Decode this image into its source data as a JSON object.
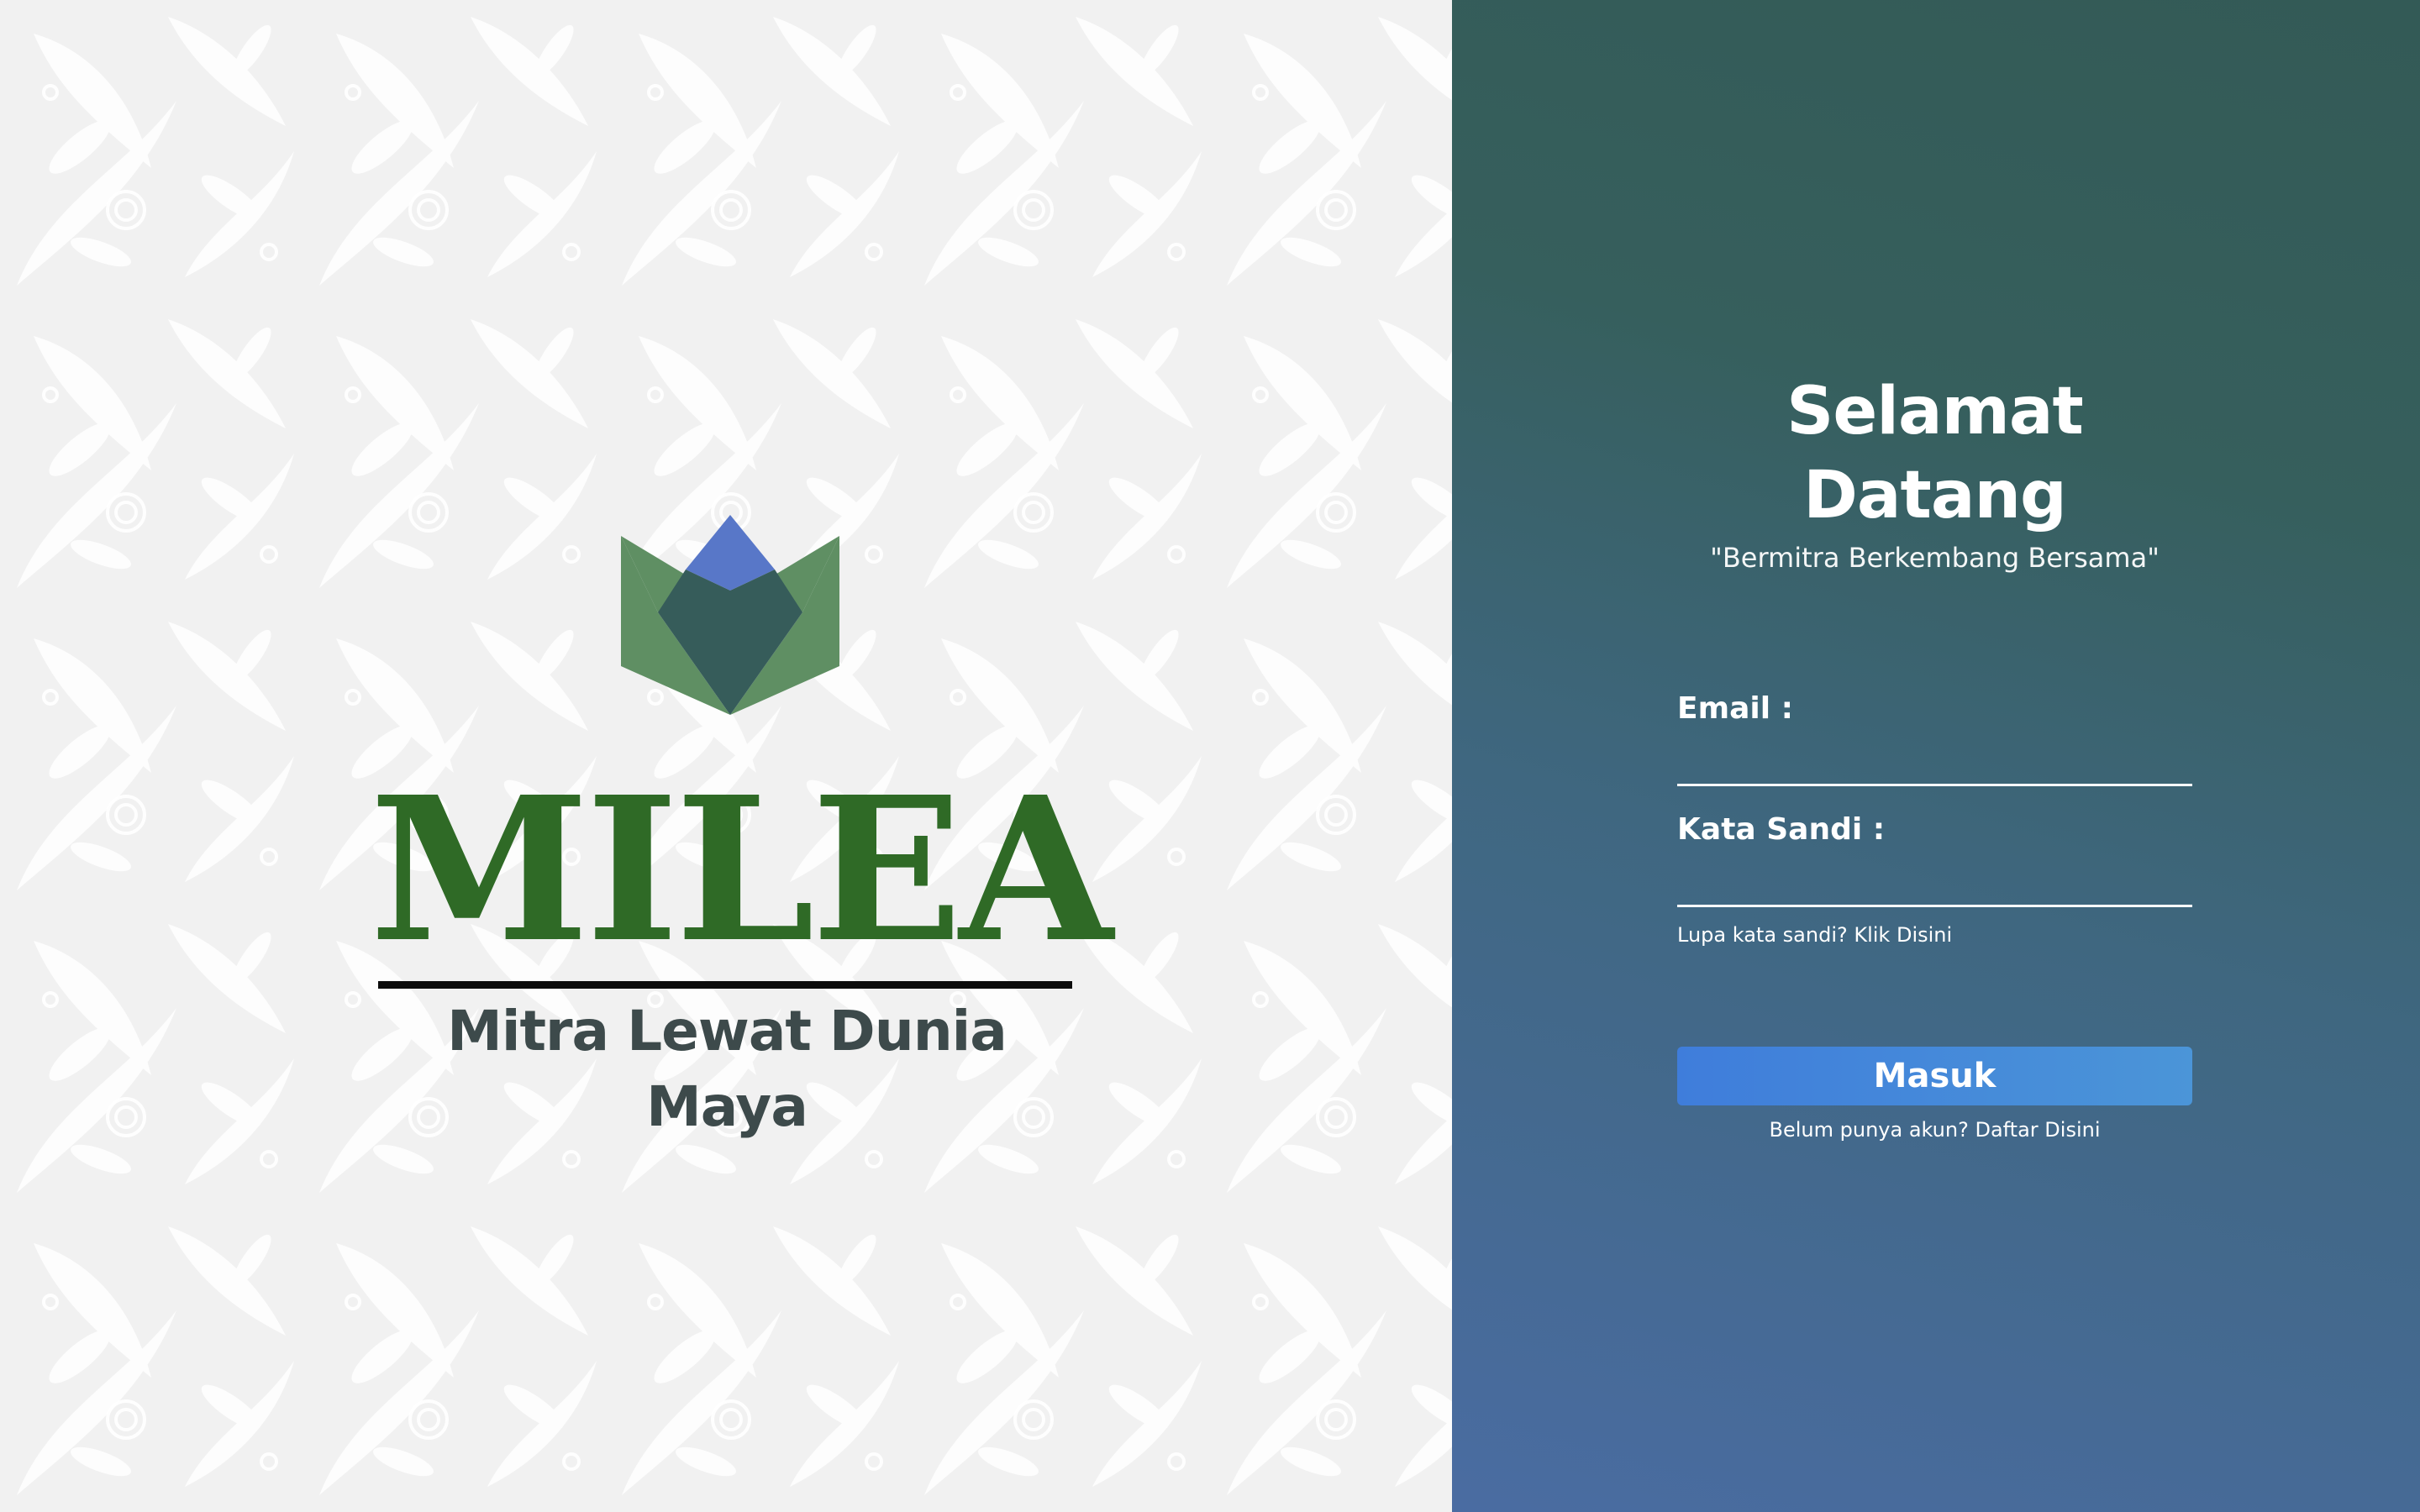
{
  "brand": {
    "name": "MILEA",
    "tagline": "Mitra Lewat Dunia Maya",
    "colors": {
      "wordmark_green": "#2f6a26",
      "leaf_green": "#5f8f63",
      "diamond_teal": "#365c5a",
      "tip_blue": "#5877c8",
      "tagline_gray": "#3d4a4b",
      "background": "#f1f1f1",
      "pattern": "#ffffff"
    }
  },
  "login": {
    "title": "Selamat Datang",
    "subtitle": "\"Bermitra Berkembang Bersama\"",
    "email_label": "Email :",
    "email_value": "",
    "password_label": "Kata Sandi :",
    "password_value": "",
    "forgot_text": "Lupa kata sandi? ",
    "forgot_link": "Klik Disini",
    "submit_label": "Masuk",
    "register_text": "Belum punya akun? ",
    "register_link": "Daftar Disini",
    "colors": {
      "panel_top": "#335a56",
      "panel_bottom": "#4a6ca2",
      "button_left": "#3f7ddb",
      "button_right": "#4b95d8",
      "text": "#ffffff"
    }
  }
}
